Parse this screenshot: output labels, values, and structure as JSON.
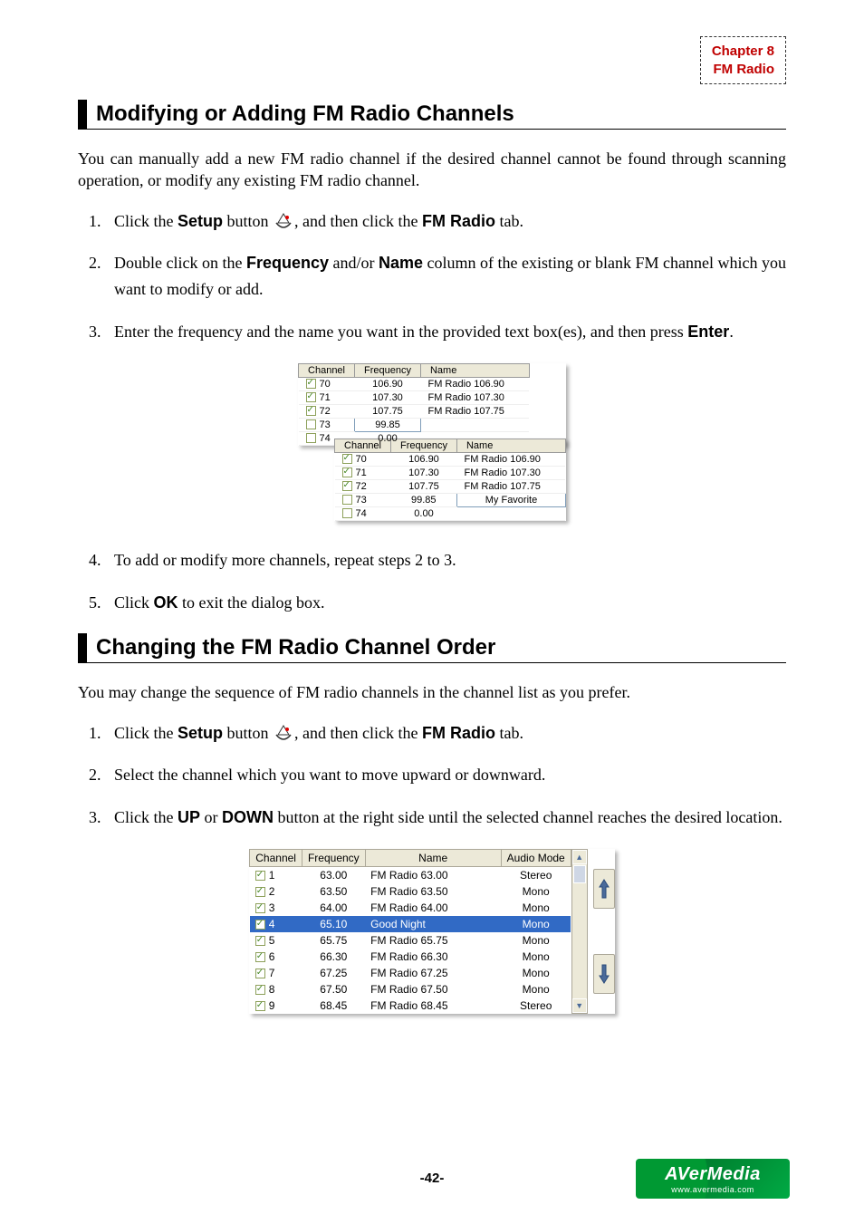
{
  "header": {
    "chapter": "Chapter 8",
    "title": "FM Radio"
  },
  "page_number": "-42-",
  "logo": {
    "brand": "AVerMedia",
    "url_text": "www.avermedia.com"
  },
  "section1": {
    "title": "Modifying or Adding FM Radio Channels",
    "intro": "You can manually add a new FM radio channel if the desired channel cannot be found through scanning operation, or modify any existing FM radio channel.",
    "steps": [
      {
        "num": "1.",
        "pre": "Click the ",
        "b1": "Setup",
        "mid": " button ",
        "icon": true,
        "post1": ", and then click the ",
        "b2": "FM Radio",
        "post2": " tab."
      },
      {
        "num": "2.",
        "pre": "Double click on the ",
        "b1": "Frequency",
        "mid": " and/or ",
        "b2": "Name",
        "post": " column of the existing or blank FM channel which you want to modify or add."
      },
      {
        "num": "3.",
        "pre": "Enter the frequency and the name you want in the provided text box(es), and then press ",
        "b1": "Enter",
        "post": "."
      },
      {
        "num": "4.",
        "text": "To add or modify more channels, repeat steps 2 to 3."
      },
      {
        "num": "5.",
        "pre": "Click ",
        "b1": "OK",
        "post": " to exit the dialog box."
      }
    ]
  },
  "fig1": {
    "headers": [
      "Channel",
      "Frequency",
      "Name"
    ],
    "top_rows": [
      {
        "on": true,
        "ch": "70",
        "freq": "106.90",
        "name": "FM Radio 106.90"
      },
      {
        "on": true,
        "ch": "71",
        "freq": "107.30",
        "name": "FM Radio 107.30"
      },
      {
        "on": true,
        "ch": "72",
        "freq": "107.75",
        "name": "FM Radio 107.75"
      },
      {
        "on": false,
        "ch": "73",
        "freq": "99.85",
        "name": "",
        "freq_edit": true
      },
      {
        "on": false,
        "ch": "74",
        "freq": "0.00",
        "name": ""
      }
    ],
    "bottom_rows": [
      {
        "on": true,
        "ch": "70",
        "freq": "106.90",
        "name": "FM Radio 106.90"
      },
      {
        "on": true,
        "ch": "71",
        "freq": "107.30",
        "name": "FM Radio 107.30"
      },
      {
        "on": true,
        "ch": "72",
        "freq": "107.75",
        "name": "FM Radio 107.75"
      },
      {
        "on": false,
        "ch": "73",
        "freq": "99.85",
        "name": "My Favorite",
        "name_edit": true
      },
      {
        "on": false,
        "ch": "74",
        "freq": "0.00",
        "name": ""
      }
    ]
  },
  "section2": {
    "title": "Changing the FM Radio Channel Order",
    "intro": "You may change the sequence of FM radio channels in the channel list as you prefer.",
    "steps": [
      {
        "num": "1.",
        "pre": "Click the ",
        "b1": "Setup",
        "mid": " button ",
        "icon": true,
        "post1": ", and then click the ",
        "b2": "FM Radio",
        "post2": " tab."
      },
      {
        "num": "2.",
        "text": "Select the channel which you want to move upward or downward."
      },
      {
        "num": "3.",
        "pre": "Click the ",
        "b1": "UP",
        "mid": " or ",
        "b2": "DOWN",
        "post": " button at the right side until the selected channel reaches the desired location."
      }
    ]
  },
  "fig2": {
    "headers": [
      "Channel",
      "Frequency",
      "Name",
      "Audio Mode"
    ],
    "rows": [
      {
        "on": true,
        "ch": "1",
        "freq": "63.00",
        "name": "FM Radio 63.00",
        "mode": "Stereo"
      },
      {
        "on": true,
        "ch": "2",
        "freq": "63.50",
        "name": "FM Radio 63.50",
        "mode": "Mono"
      },
      {
        "on": true,
        "ch": "3",
        "freq": "64.00",
        "name": "FM Radio 64.00",
        "mode": "Mono"
      },
      {
        "on": true,
        "ch": "4",
        "freq": "65.10",
        "name": "Good Night",
        "mode": "Mono",
        "sel": true
      },
      {
        "on": true,
        "ch": "5",
        "freq": "65.75",
        "name": "FM Radio 65.75",
        "mode": "Mono"
      },
      {
        "on": true,
        "ch": "6",
        "freq": "66.30",
        "name": "FM Radio 66.30",
        "mode": "Mono"
      },
      {
        "on": true,
        "ch": "7",
        "freq": "67.25",
        "name": "FM Radio 67.25",
        "mode": "Mono"
      },
      {
        "on": true,
        "ch": "8",
        "freq": "67.50",
        "name": "FM Radio 67.50",
        "mode": "Mono"
      },
      {
        "on": true,
        "ch": "9",
        "freq": "68.45",
        "name": "FM Radio 68.45",
        "mode": "Stereo"
      }
    ]
  }
}
